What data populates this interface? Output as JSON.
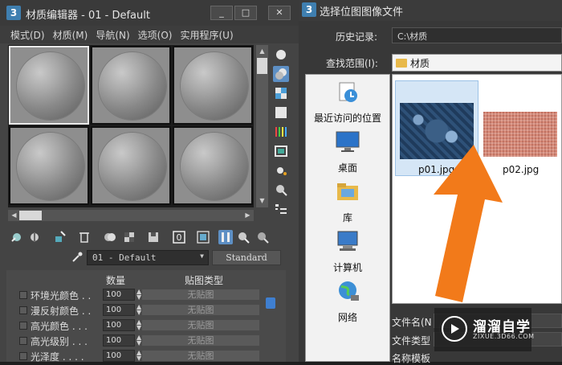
{
  "material_editor": {
    "app_icon": "3",
    "title": "材质编辑器 - 01 - Default",
    "window_buttons": [
      "_",
      "□",
      "✕"
    ],
    "menu": [
      "模式(D)",
      "材质(M)",
      "导航(N)",
      "选项(O)",
      "实用程序(U)"
    ],
    "material_name": "01 - Default",
    "material_type": "Standard",
    "params": {
      "header_amount": "数量",
      "header_maptype": "贴图类型",
      "rows": [
        {
          "label": "环境光颜色 . .",
          "amount": "100",
          "map": "无贴图"
        },
        {
          "label": "漫反射颜色 . .",
          "amount": "100",
          "map": "无贴图"
        },
        {
          "label": "高光颜色 . . .",
          "amount": "100",
          "map": "无贴图"
        },
        {
          "label": "高光级别 . . .",
          "amount": "100",
          "map": "无贴图"
        },
        {
          "label": "光泽度 . . . .",
          "amount": "100",
          "map": "无贴图"
        }
      ]
    }
  },
  "file_dialog": {
    "app_icon": "3",
    "title": "选择位图图像文件",
    "history_label": "历史记录:",
    "history_value": "C:\\材质",
    "lookin_label": "查找范围(I):",
    "lookin_value": "材质",
    "places": [
      "最近访问的位置",
      "桌面",
      "库",
      "计算机",
      "网络"
    ],
    "files": [
      {
        "name": "p01.jpg",
        "selected": true
      },
      {
        "name": "p02.jpg",
        "selected": false
      }
    ],
    "filename_label": "文件名(N",
    "filetype_label": "文件类型",
    "template_label": "名称模板"
  },
  "watermark": {
    "text": "溜溜自学",
    "url": "ZIXUE.3D66.COM"
  },
  "colors": {
    "accent": "#5d8fc4",
    "arrow": "#f27a1a"
  }
}
